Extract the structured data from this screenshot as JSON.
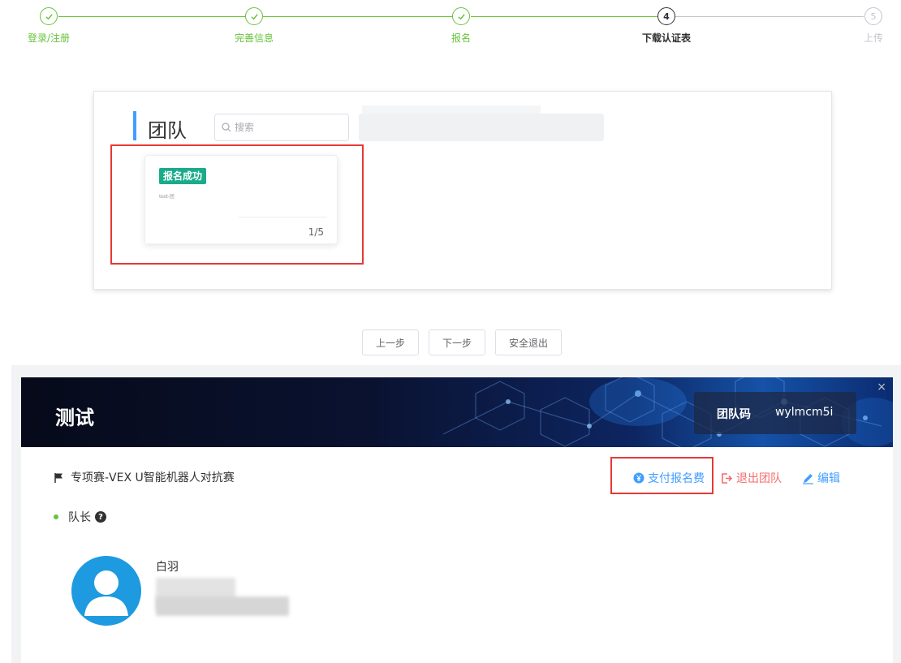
{
  "stepper": {
    "steps": [
      {
        "index": "1",
        "label": "登录/注册",
        "state": "done"
      },
      {
        "index": "2",
        "label": "完善信息",
        "state": "done"
      },
      {
        "index": "3",
        "label": "报名",
        "state": "done"
      },
      {
        "index": "4",
        "label": "下载认证表",
        "state": "active"
      },
      {
        "index": "5",
        "label": "上传",
        "state": "todo"
      }
    ]
  },
  "team_panel": {
    "title": "团队",
    "search": {
      "placeholder": "搜索",
      "value": ""
    },
    "card": {
      "status": "报名成功",
      "small_text": "test-团",
      "member_count": "1/5"
    }
  },
  "buttons": {
    "prev": "上一步",
    "next": "下一步",
    "logout": "安全退出"
  },
  "team_dialog": {
    "banner_title": "测试",
    "team_code_label": "团队码",
    "team_code": "wylmcm5i",
    "close": "×",
    "competition": "专项赛-VEX U智能机器人对抗赛",
    "actions": {
      "pay": "支付报名费",
      "leave": "退出团队",
      "edit": "编辑"
    },
    "role_label": "队长",
    "help": "?",
    "member_name": "白羽"
  },
  "colors": {
    "done": "#67c23a",
    "primary": "#409eff",
    "danger": "#f56c6c",
    "success_tag": "#1aab8a",
    "highlight": "#e53935"
  }
}
